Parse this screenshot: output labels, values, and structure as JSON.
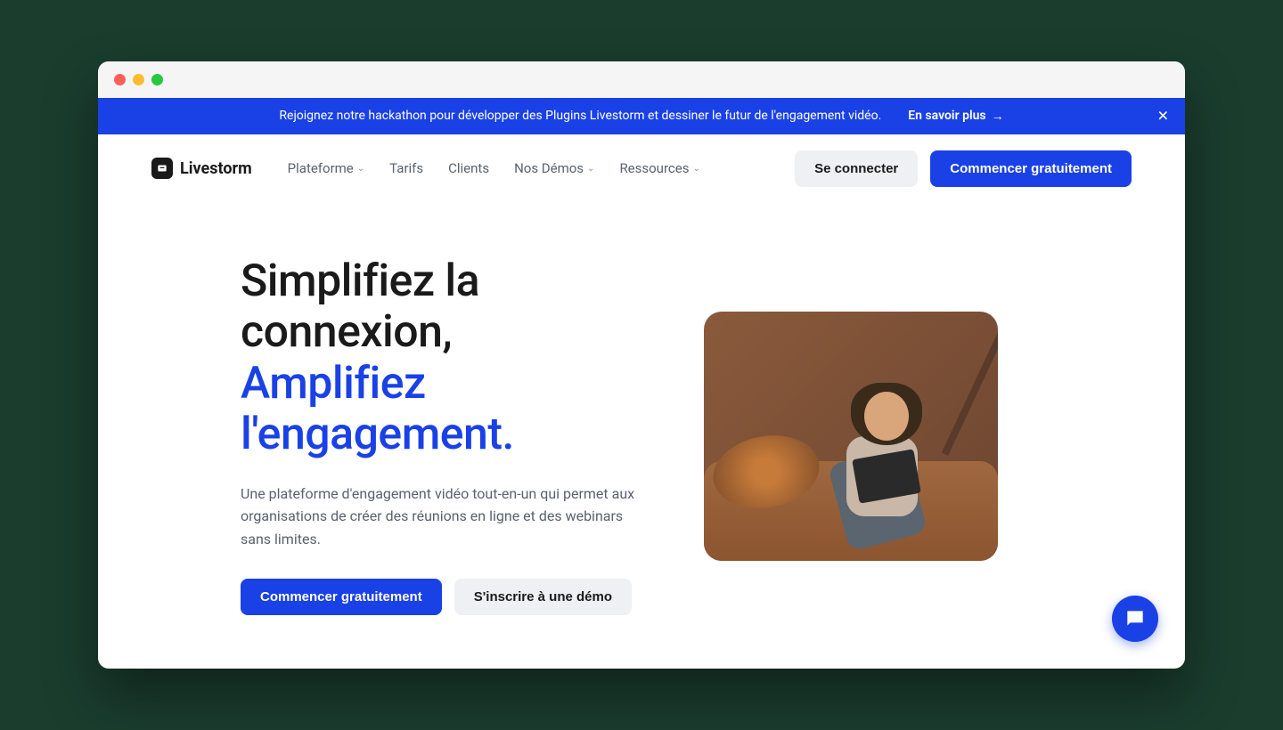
{
  "announcement": {
    "text": "Rejoignez notre hackathon pour développer des Plugins Livestorm et dessiner le futur de l'engagement vidéo.",
    "link_label": "En savoir plus"
  },
  "brand": {
    "name": "Livestorm"
  },
  "nav": {
    "items": [
      {
        "label": "Plateforme",
        "has_dropdown": true
      },
      {
        "label": "Tarifs",
        "has_dropdown": false
      },
      {
        "label": "Clients",
        "has_dropdown": false
      },
      {
        "label": "Nos Démos",
        "has_dropdown": true
      },
      {
        "label": "Ressources",
        "has_dropdown": true
      }
    ],
    "login_label": "Se connecter",
    "cta_label": "Commencer gratuitement"
  },
  "hero": {
    "title_line1": "Simplifiez la connexion,",
    "title_line2": "Amplifiez l'engagement.",
    "subtitle": "Une plateforme d'engagement vidéo tout-en-un qui permet aux organisations de créer des réunions en ligne et des webinars sans limites.",
    "primary_cta": "Commencer gratuitement",
    "secondary_cta": "S'inscrire à une démo"
  }
}
